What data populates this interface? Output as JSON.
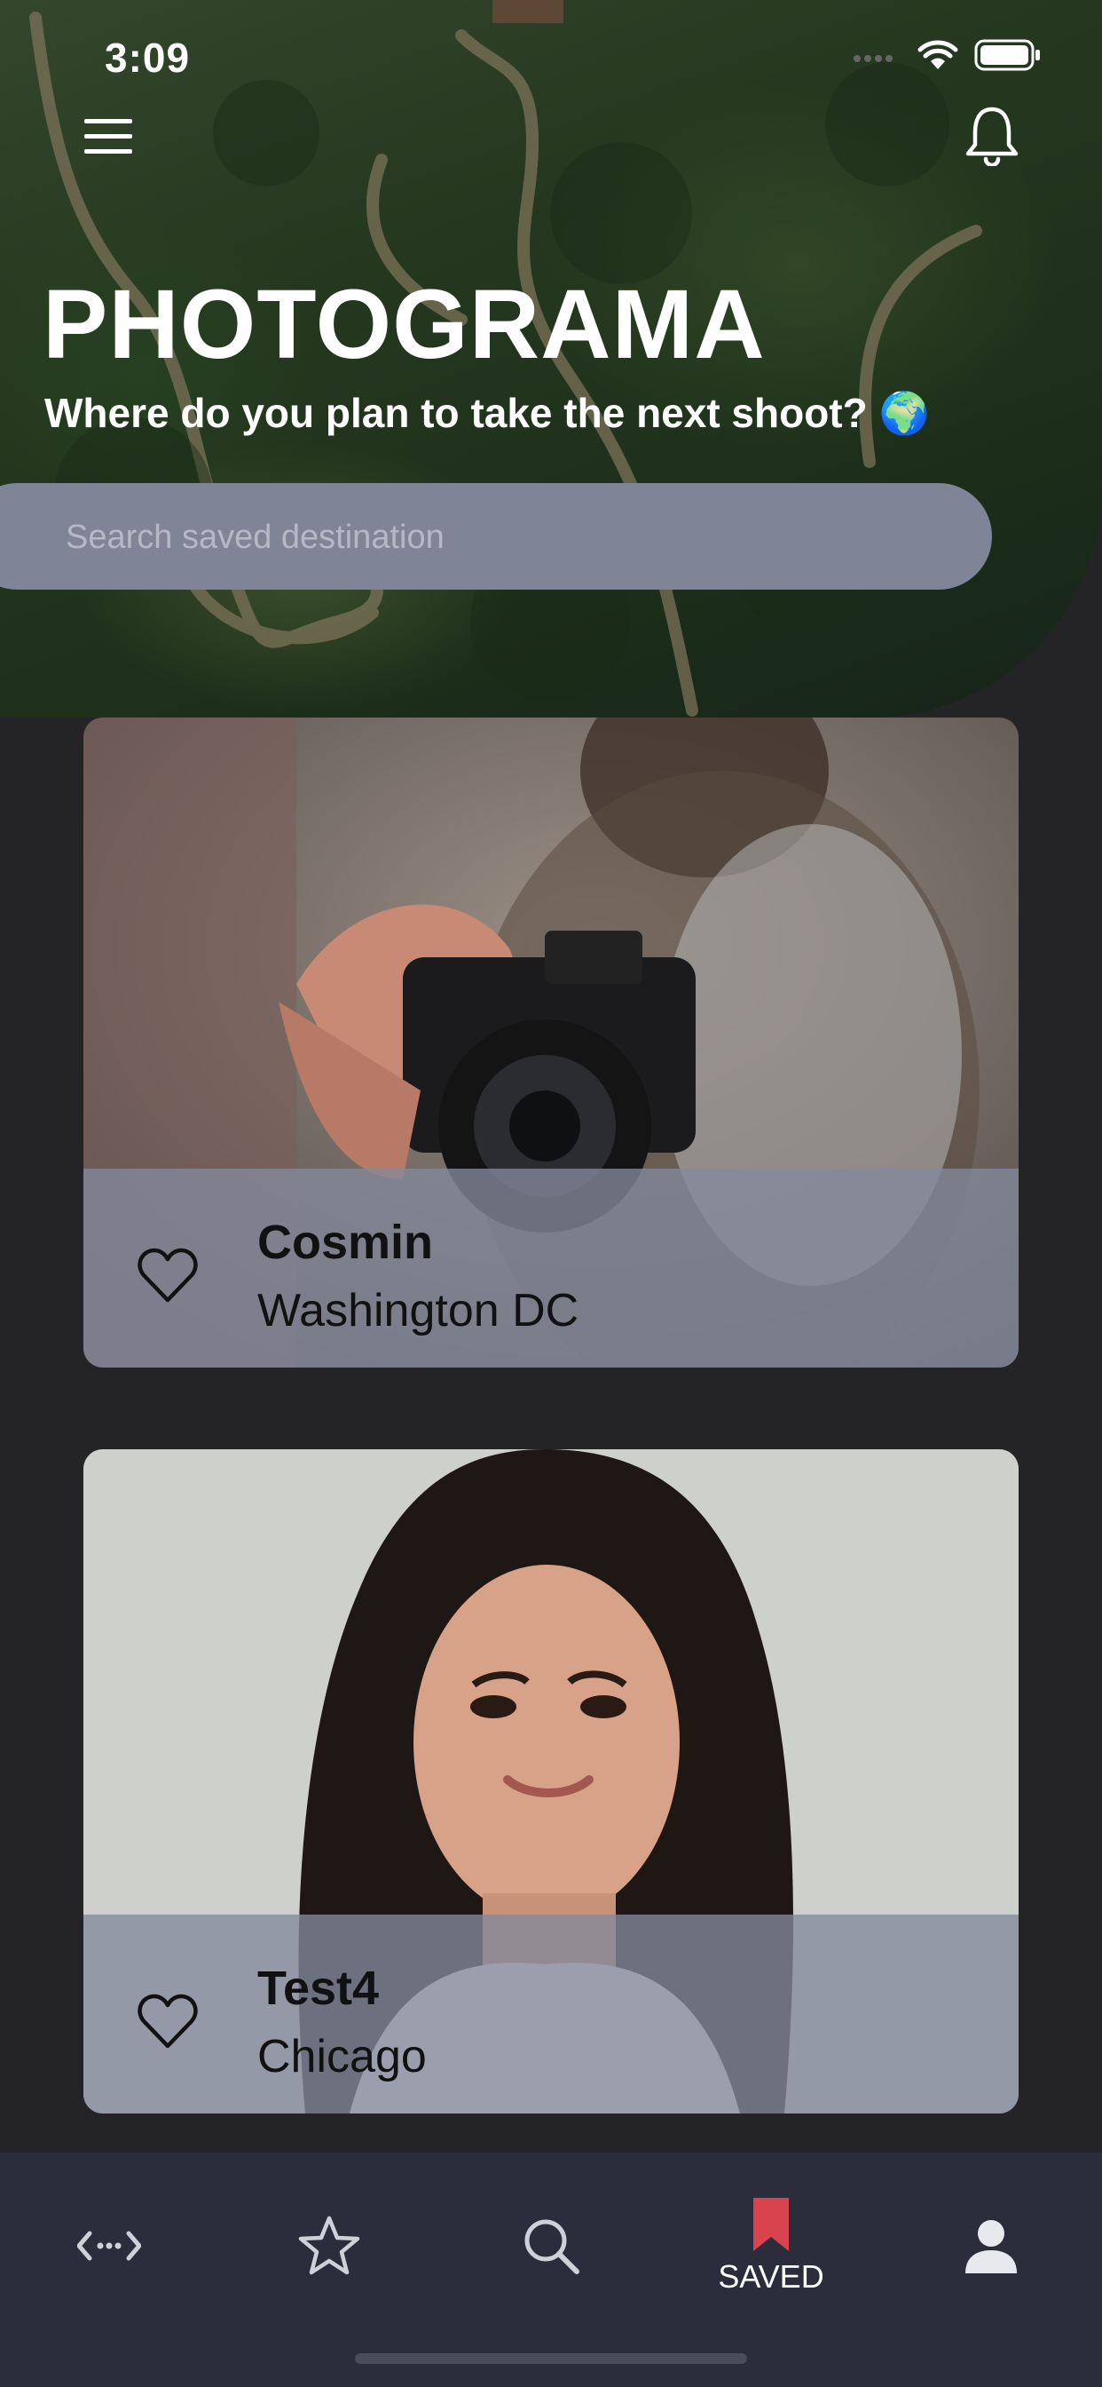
{
  "status_bar": {
    "time": "3:09"
  },
  "header": {
    "menu_icon": "hamburger-menu-icon",
    "notification_icon": "bell-icon",
    "title": "PHOTOGRAMA",
    "subtitle": "Where do you plan to take the next shoot? 🌍"
  },
  "search": {
    "placeholder": "Search saved destination",
    "value": ""
  },
  "cards": [
    {
      "name": "Cosmin",
      "city": "Washington DC",
      "favorite_icon": "heart-outline-icon"
    },
    {
      "name": "Test4",
      "city": "Chicago",
      "favorite_icon": "heart-outline-icon"
    }
  ],
  "tabbar": {
    "active_color": "#d9434e",
    "tabs": [
      {
        "icon": "code-arrows-icon",
        "label": ""
      },
      {
        "icon": "star-icon",
        "label": ""
      },
      {
        "icon": "search-icon",
        "label": ""
      },
      {
        "icon": "bookmark-icon",
        "label": "SAVED",
        "active": true
      },
      {
        "icon": "user-icon",
        "label": ""
      }
    ]
  }
}
